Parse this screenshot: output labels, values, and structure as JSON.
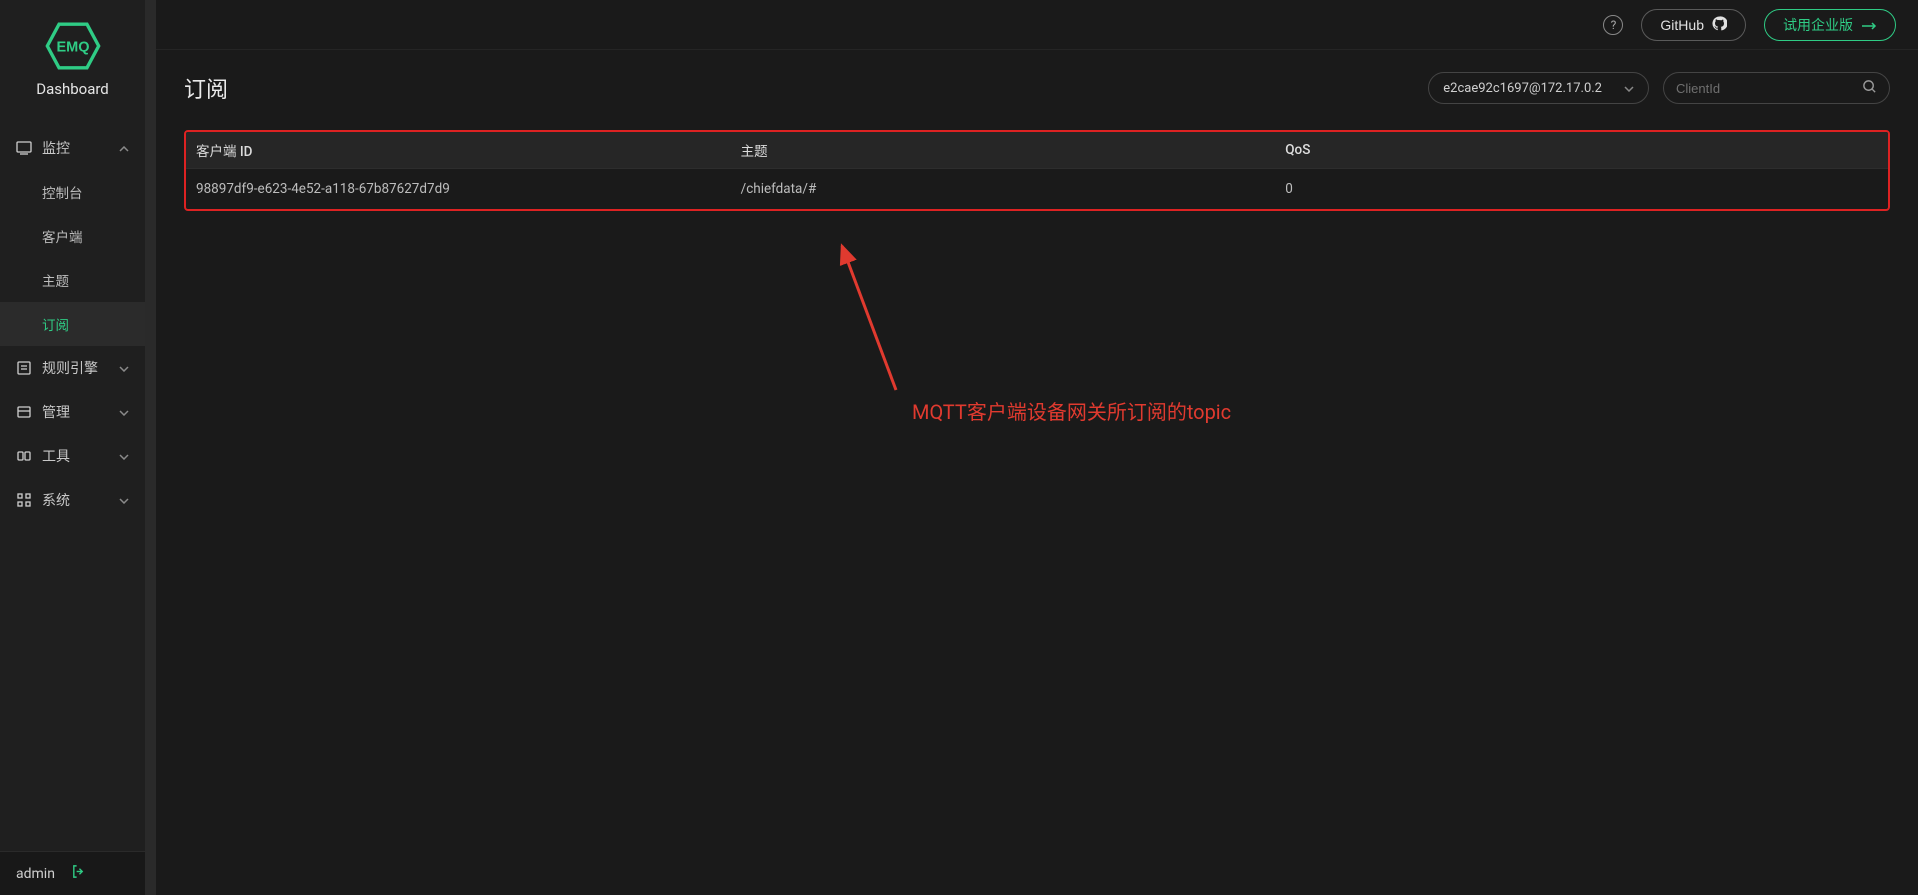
{
  "brand": {
    "logo_text": "EMQ",
    "subtitle": "Dashboard"
  },
  "sidebar": {
    "groups": [
      {
        "icon": "monitor-icon",
        "label": "监控",
        "expanded": true,
        "items": [
          {
            "label": "控制台"
          },
          {
            "label": "客户端"
          },
          {
            "label": "主题"
          },
          {
            "label": "订阅",
            "active": true
          }
        ]
      },
      {
        "icon": "rules-icon",
        "label": "规则引擎",
        "expanded": false
      },
      {
        "icon": "manage-icon",
        "label": "管理",
        "expanded": false
      },
      {
        "icon": "tools-icon",
        "label": "工具",
        "expanded": false
      },
      {
        "icon": "system-icon",
        "label": "系统",
        "expanded": false
      }
    ],
    "footer": {
      "user": "admin"
    }
  },
  "topbar": {
    "github_label": "GitHub",
    "enterprise_label": "试用企业版"
  },
  "page": {
    "title": "订阅",
    "node_selector": {
      "value": "e2cae92c1697@172.17.0.2"
    },
    "search": {
      "placeholder": "ClientId",
      "value": ""
    }
  },
  "table": {
    "columns": {
      "client_id": "客户端 ID",
      "topic": "主题",
      "qos": "QoS"
    },
    "rows": [
      {
        "client_id": "98897df9-e623-4e52-a118-67b87627d7d9",
        "topic": "/chiefdata/#",
        "qos": "0"
      }
    ]
  },
  "annotation": {
    "text": "MQTT客户端设备网关所订阅的topic"
  },
  "colors": {
    "accent": "#2fcc85",
    "danger": "#d22"
  }
}
